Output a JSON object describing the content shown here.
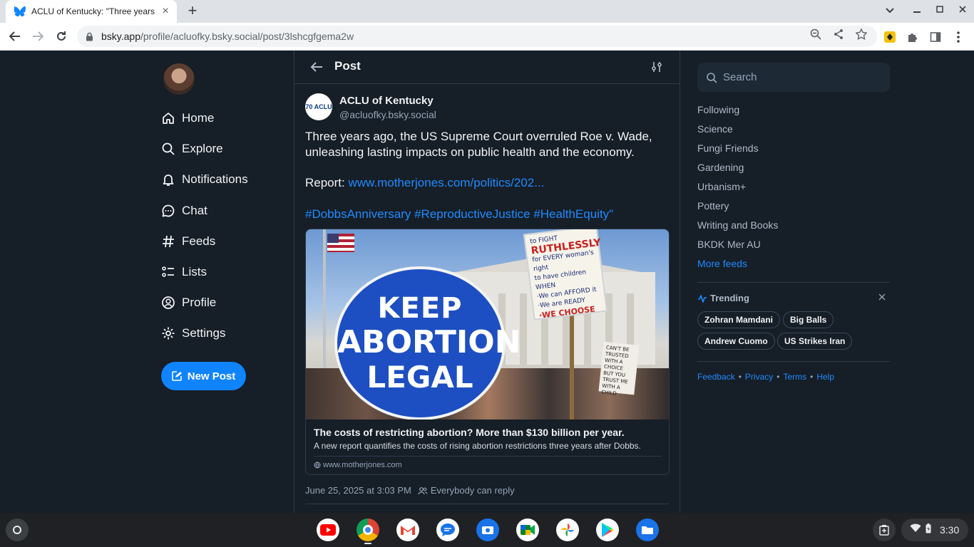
{
  "browser": {
    "tab_title": "ACLU of Kentucky: \"Three years a",
    "url_host": "bsky.app",
    "url_path": "/profile/acluofky.bsky.social/post/3lshcgfgema2w"
  },
  "nav": {
    "items": [
      {
        "label": "Home",
        "icon": "home-icon"
      },
      {
        "label": "Explore",
        "icon": "search-icon"
      },
      {
        "label": "Notifications",
        "icon": "bell-icon"
      },
      {
        "label": "Chat",
        "icon": "chat-icon"
      },
      {
        "label": "Feeds",
        "icon": "hashtag-icon"
      },
      {
        "label": "Lists",
        "icon": "list-icon"
      },
      {
        "label": "Profile",
        "icon": "profile-icon"
      },
      {
        "label": "Settings",
        "icon": "gear-icon"
      }
    ],
    "new_post_label": "New Post"
  },
  "header": {
    "title": "Post"
  },
  "post": {
    "author_name": "ACLU of Kentucky",
    "author_handle": "@acluofky.bsky.social",
    "avatar_text": "70 ACLU",
    "text_line1": "Three years ago, the US Supreme Court overruled Roe v. Wade, unleashing lasting impacts on public health and the economy.",
    "report_prefix": "Report: ",
    "report_link": "www.motherjones.com/politics/202...",
    "hashtags": "#DobbsAnniversary #ReproductiveJustice #HealthEquity\"",
    "timestamp": "June 25, 2025 at 3:03 PM",
    "reply_setting": "Everybody can reply",
    "embed": {
      "sign_line1": "KEEP",
      "sign_line2": "ABORTION",
      "sign_line3": "LEGAL",
      "title": "The costs of restricting abortion? More than $130 billion per year.",
      "description": "A new report quantifies the costs of rising abortion restrictions three years after Dobbs.",
      "domain": "www.motherjones.com"
    }
  },
  "right": {
    "search_placeholder": "Search",
    "feeds": [
      "Following",
      "Science",
      "Fungi Friends",
      "Gardening",
      "Urbanism+",
      "Pottery",
      "Writing and Books",
      "BKDK Mer AU"
    ],
    "more_feeds": "More feeds",
    "trending_title": "Trending",
    "trending": [
      "Zohran Mamdani",
      "Big Balls",
      "Andrew Cuomo",
      "US Strikes Iran"
    ],
    "footer": [
      "Feedback",
      "Privacy",
      "Terms",
      "Help"
    ]
  },
  "shelf": {
    "apps": [
      "youtube-icon",
      "chrome-icon",
      "gmail-icon",
      "messages-icon",
      "camera-icon",
      "meet-icon",
      "photos-icon",
      "play-store-icon",
      "files-icon"
    ],
    "time": "3:30"
  },
  "colors": {
    "accent": "#208bfe",
    "background": "#161e27",
    "button": "#1083fe"
  }
}
